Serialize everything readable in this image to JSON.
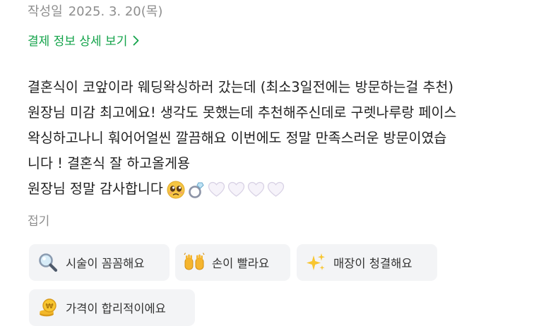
{
  "header": {
    "date_label": "작성일",
    "date_value": "2025. 3. 20(목)"
  },
  "payment_link": {
    "label": "결제 정보 상세 보기",
    "icon": "chevron-right-icon",
    "color": "#13a34a"
  },
  "review": {
    "lines": [
      "결혼식이 코앞이라 웨딩왁싱하러 갔는데 (최소3일전에는 방문하는걸 추천)",
      "원장님 미감 최고에요! 생각도 못했는데 추천해주신데로 구렛나루랑 페이스",
      "왁싱하고나니 훠어어얼씬 깔끔해요 이번에도 정말 만족스러운 방문이였습",
      "니다 ! 결혼식 잘 하고올게용",
      "원장님 정말 감사합니다"
    ],
    "trailing_emojis": [
      "pleading-face-icon",
      "ring-icon",
      "white-heart-icon",
      "white-heart-icon",
      "white-heart-icon",
      "white-heart-icon"
    ]
  },
  "fold_label": "접기",
  "keyword_chips": [
    {
      "label": "시술이 꼼꼼해요",
      "icon": "magnifying-glass-icon"
    },
    {
      "label": "손이 빨라요",
      "icon": "raising-hands-icon"
    },
    {
      "label": "매장이 청결해요",
      "icon": "sparkles-icon"
    },
    {
      "label": "가격이 합리적이에요",
      "icon": "coin-icon"
    }
  ],
  "colors": {
    "text_primary": "#222222",
    "text_secondary": "#8e8e8e",
    "chip_background": "#f3f4f6"
  }
}
